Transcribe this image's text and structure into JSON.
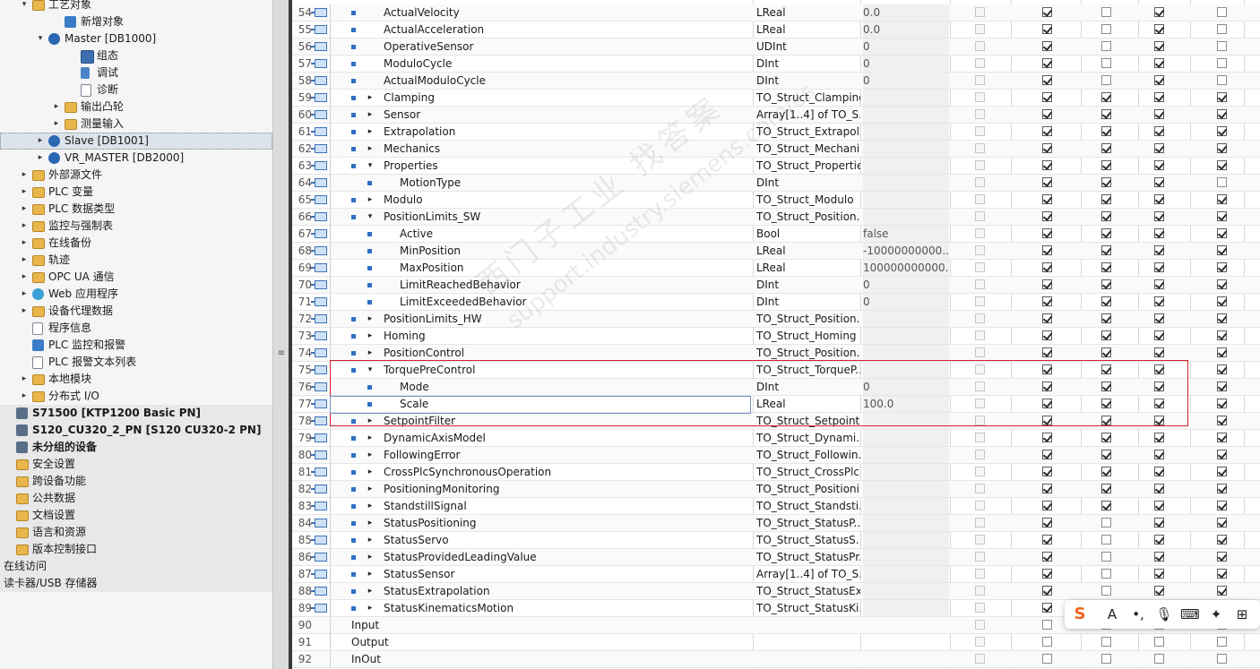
{
  "tree": [
    {
      "label": "工艺对象",
      "indent": 1,
      "arrow": "▾",
      "icon": "folder",
      "state": ""
    },
    {
      "label": "新增对象",
      "indent": 3,
      "arrow": "",
      "icon": "blue",
      "state": ""
    },
    {
      "label": "Master [DB1000]",
      "indent": 2,
      "arrow": "▾",
      "icon": "gear",
      "state": ""
    },
    {
      "label": "组态",
      "indent": 4,
      "arrow": "",
      "icon": "cfg",
      "state": ""
    },
    {
      "label": "调试",
      "indent": 4,
      "arrow": "",
      "icon": "tool",
      "state": ""
    },
    {
      "label": "诊断",
      "indent": 4,
      "arrow": "",
      "icon": "doc",
      "state": ""
    },
    {
      "label": "输出凸轮",
      "indent": 3,
      "arrow": "▸",
      "icon": "folder",
      "state": ""
    },
    {
      "label": "测量输入",
      "indent": 3,
      "arrow": "▸",
      "icon": "folder",
      "state": ""
    },
    {
      "label": "Slave [DB1001]",
      "indent": 2,
      "arrow": "▸",
      "icon": "gear",
      "state": "sel dotted"
    },
    {
      "label": "VR_MASTER [DB2000]",
      "indent": 2,
      "arrow": "▸",
      "icon": "gear",
      "state": ""
    },
    {
      "label": "外部源文件",
      "indent": 1,
      "arrow": "▸",
      "icon": "folder",
      "state": ""
    },
    {
      "label": "PLC 变量",
      "indent": 1,
      "arrow": "▸",
      "icon": "folder",
      "state": ""
    },
    {
      "label": "PLC 数据类型",
      "indent": 1,
      "arrow": "▸",
      "icon": "folder",
      "state": ""
    },
    {
      "label": "监控与强制表",
      "indent": 1,
      "arrow": "▸",
      "icon": "folder",
      "state": ""
    },
    {
      "label": "在线备份",
      "indent": 1,
      "arrow": "▸",
      "icon": "folder",
      "state": ""
    },
    {
      "label": "轨迹",
      "indent": 1,
      "arrow": "▸",
      "icon": "folder",
      "state": ""
    },
    {
      "label": "OPC UA 通信",
      "indent": 1,
      "arrow": "▸",
      "icon": "folder",
      "state": ""
    },
    {
      "label": "Web 应用程序",
      "indent": 1,
      "arrow": "▸",
      "icon": "net",
      "state": ""
    },
    {
      "label": "设备代理数据",
      "indent": 1,
      "arrow": "▸",
      "icon": "folder",
      "state": ""
    },
    {
      "label": "程序信息",
      "indent": 1,
      "arrow": "",
      "icon": "doc",
      "state": ""
    },
    {
      "label": "PLC 监控和报警",
      "indent": 1,
      "arrow": "",
      "icon": "blue",
      "state": ""
    },
    {
      "label": "PLC 报警文本列表",
      "indent": 1,
      "arrow": "",
      "icon": "doc",
      "state": ""
    },
    {
      "label": "本地模块",
      "indent": 1,
      "arrow": "▸",
      "icon": "folder",
      "state": ""
    },
    {
      "label": "分布式 I/O",
      "indent": 1,
      "arrow": "▸",
      "icon": "folder",
      "state": ""
    },
    {
      "label": "S71500 [KTP1200 Basic PN]",
      "indent": 0,
      "arrow": "",
      "icon": "dev",
      "state": "gray bold"
    },
    {
      "label": "S120_CU320_2_PN [S120 CU320-2 PN]",
      "indent": 0,
      "arrow": "",
      "icon": "dev",
      "state": "gray bold"
    },
    {
      "label": "未分组的设备",
      "indent": 0,
      "arrow": "",
      "icon": "dev",
      "state": "gray bold"
    },
    {
      "label": "安全设置",
      "indent": 0,
      "arrow": "",
      "icon": "folder",
      "state": "gray"
    },
    {
      "label": "跨设备功能",
      "indent": 0,
      "arrow": "",
      "icon": "folder",
      "state": "gray"
    },
    {
      "label": "公共数据",
      "indent": 0,
      "arrow": "",
      "icon": "folder",
      "state": "gray"
    },
    {
      "label": "文档设置",
      "indent": 0,
      "arrow": "",
      "icon": "folder",
      "state": "gray"
    },
    {
      "label": "语言和资源",
      "indent": 0,
      "arrow": "",
      "icon": "folder",
      "state": "gray"
    },
    {
      "label": "版本控制接口",
      "indent": 0,
      "arrow": "",
      "icon": "folder",
      "state": "gray"
    },
    {
      "label": "在线访问",
      "indent": 0,
      "arrow": "",
      "icon": "",
      "state": "gray"
    },
    {
      "label": "读卡器/USB 存储器",
      "indent": 0,
      "arrow": "",
      "icon": "",
      "state": "gray"
    }
  ],
  "splitter_grip": "≡",
  "rows": [
    {
      "num": "54",
      "icon": true,
      "level": 1,
      "exp": "",
      "name": "ActualVelocity",
      "type": "LReal",
      "start": "0.0",
      "cb": [
        0,
        1,
        0,
        1,
        0
      ]
    },
    {
      "num": "55",
      "icon": true,
      "level": 1,
      "exp": "",
      "name": "ActualAcceleration",
      "type": "LReal",
      "start": "0.0",
      "cb": [
        0,
        1,
        0,
        1,
        0
      ]
    },
    {
      "num": "56",
      "icon": true,
      "level": 1,
      "exp": "",
      "name": "OperativeSensor",
      "type": "UDInt",
      "start": "0",
      "cb": [
        0,
        1,
        0,
        1,
        0
      ]
    },
    {
      "num": "57",
      "icon": true,
      "level": 1,
      "exp": "",
      "name": "ModuloCycle",
      "type": "DInt",
      "start": "0",
      "cb": [
        0,
        1,
        0,
        1,
        0
      ]
    },
    {
      "num": "58",
      "icon": true,
      "level": 1,
      "exp": "",
      "name": "ActualModuloCycle",
      "type": "DInt",
      "start": "0",
      "cb": [
        0,
        1,
        0,
        1,
        0
      ]
    },
    {
      "num": "59",
      "icon": true,
      "level": 1,
      "exp": "▸",
      "name": "Clamping",
      "type": "TO_Struct_Clamping",
      "start": "",
      "cb": [
        0,
        1,
        1,
        1,
        1
      ]
    },
    {
      "num": "60",
      "icon": true,
      "level": 1,
      "exp": "▸",
      "name": "Sensor",
      "type": "Array[1..4] of TO_S...",
      "start": "",
      "cb": [
        0,
        1,
        1,
        1,
        1
      ]
    },
    {
      "num": "61",
      "icon": true,
      "level": 1,
      "exp": "▸",
      "name": "Extrapolation",
      "type": "TO_Struct_Extrapol...",
      "start": "",
      "cb": [
        0,
        1,
        1,
        1,
        1
      ]
    },
    {
      "num": "62",
      "icon": true,
      "level": 1,
      "exp": "▸",
      "name": "Mechanics",
      "type": "TO_Struct_Mechani...",
      "start": "",
      "cb": [
        0,
        1,
        1,
        1,
        1
      ]
    },
    {
      "num": "63",
      "icon": true,
      "level": 1,
      "exp": "▾",
      "name": "Properties",
      "type": "TO_Struct_Properties",
      "start": "",
      "cb": [
        0,
        1,
        1,
        1,
        1
      ]
    },
    {
      "num": "64",
      "icon": true,
      "level": 2,
      "exp": "",
      "name": "MotionType",
      "type": "DInt",
      "start": "",
      "cb": [
        0,
        1,
        1,
        1,
        0
      ]
    },
    {
      "num": "65",
      "icon": true,
      "level": 1,
      "exp": "▸",
      "name": "Modulo",
      "type": "TO_Struct_Modulo",
      "start": "",
      "cb": [
        0,
        1,
        1,
        1,
        1
      ]
    },
    {
      "num": "66",
      "icon": true,
      "level": 1,
      "exp": "▾",
      "name": "PositionLimits_SW",
      "type": "TO_Struct_Position...",
      "start": "",
      "cb": [
        0,
        1,
        1,
        1,
        1
      ]
    },
    {
      "num": "67",
      "icon": true,
      "level": 2,
      "exp": "",
      "name": "Active",
      "type": "Bool",
      "start": "false",
      "cb": [
        0,
        1,
        1,
        1,
        1
      ]
    },
    {
      "num": "68",
      "icon": true,
      "level": 2,
      "exp": "",
      "name": "MinPosition",
      "type": "LReal",
      "start": "-10000000000...0",
      "cb": [
        0,
        1,
        1,
        1,
        1
      ]
    },
    {
      "num": "69",
      "icon": true,
      "level": 2,
      "exp": "",
      "name": "MaxPosition",
      "type": "LReal",
      "start": "100000000000...",
      "cb": [
        0,
        1,
        1,
        1,
        1
      ]
    },
    {
      "num": "70",
      "icon": true,
      "level": 2,
      "exp": "",
      "name": "LimitReachedBehavior",
      "type": "DInt",
      "start": "0",
      "cb": [
        0,
        1,
        1,
        1,
        1
      ]
    },
    {
      "num": "71",
      "icon": true,
      "level": 2,
      "exp": "",
      "name": "LimitExceededBehavior",
      "type": "DInt",
      "start": "0",
      "cb": [
        0,
        1,
        1,
        1,
        1
      ]
    },
    {
      "num": "72",
      "icon": true,
      "level": 1,
      "exp": "▸",
      "name": "PositionLimits_HW",
      "type": "TO_Struct_Position...",
      "start": "",
      "cb": [
        0,
        1,
        1,
        1,
        1
      ]
    },
    {
      "num": "73",
      "icon": true,
      "level": 1,
      "exp": "▸",
      "name": "Homing",
      "type": "TO_Struct_Homing",
      "start": "",
      "cb": [
        0,
        1,
        1,
        1,
        1
      ]
    },
    {
      "num": "74",
      "icon": true,
      "level": 1,
      "exp": "▸",
      "name": "PositionControl",
      "type": "TO_Struct_Position...",
      "start": "",
      "cb": [
        0,
        1,
        1,
        1,
        1
      ]
    },
    {
      "num": "75",
      "icon": true,
      "level": 1,
      "exp": "▾",
      "name": "TorquePreControl",
      "type": "TO_Struct_TorqueP...",
      "start": "",
      "cb": [
        0,
        1,
        1,
        1,
        1
      ]
    },
    {
      "num": "76",
      "icon": true,
      "level": 2,
      "exp": "",
      "name": "Mode",
      "type": "DInt",
      "start": "0",
      "cb": [
        0,
        1,
        1,
        1,
        1
      ]
    },
    {
      "num": "77",
      "icon": true,
      "level": 2,
      "exp": "",
      "name": "Scale",
      "type": "LReal",
      "start": "100.0",
      "cb": [
        0,
        1,
        1,
        1,
        1
      ]
    },
    {
      "num": "78",
      "icon": true,
      "level": 1,
      "exp": "▸",
      "name": "SetpointFilter",
      "type": "TO_Struct_Setpoint...",
      "start": "",
      "cb": [
        0,
        1,
        1,
        1,
        1
      ]
    },
    {
      "num": "79",
      "icon": true,
      "level": 1,
      "exp": "▸",
      "name": "DynamicAxisModel",
      "type": "TO_Struct_Dynami...",
      "start": "",
      "cb": [
        0,
        1,
        1,
        1,
        1
      ]
    },
    {
      "num": "80",
      "icon": true,
      "level": 1,
      "exp": "▸",
      "name": "FollowingError",
      "type": "TO_Struct_Followin...",
      "start": "",
      "cb": [
        0,
        1,
        1,
        1,
        1
      ]
    },
    {
      "num": "81",
      "icon": true,
      "level": 1,
      "exp": "▸",
      "name": "CrossPlcSynchronousOperation",
      "type": "TO_Struct_CrossPlc...",
      "start": "",
      "cb": [
        0,
        1,
        1,
        1,
        1
      ]
    },
    {
      "num": "82",
      "icon": true,
      "level": 1,
      "exp": "▸",
      "name": "PositioningMonitoring",
      "type": "TO_Struct_Positioni...",
      "start": "",
      "cb": [
        0,
        1,
        1,
        1,
        1
      ]
    },
    {
      "num": "83",
      "icon": true,
      "level": 1,
      "exp": "▸",
      "name": "StandstillSignal",
      "type": "TO_Struct_Standsti...",
      "start": "",
      "cb": [
        0,
        1,
        1,
        1,
        1
      ]
    },
    {
      "num": "84",
      "icon": true,
      "level": 1,
      "exp": "▸",
      "name": "StatusPositioning",
      "type": "TO_Struct_StatusP...",
      "start": "",
      "cb": [
        0,
        1,
        0,
        1,
        1
      ]
    },
    {
      "num": "85",
      "icon": true,
      "level": 1,
      "exp": "▸",
      "name": "StatusServo",
      "type": "TO_Struct_StatusS...",
      "start": "",
      "cb": [
        0,
        1,
        0,
        1,
        1
      ]
    },
    {
      "num": "86",
      "icon": true,
      "level": 1,
      "exp": "▸",
      "name": "StatusProvidedLeadingValue",
      "type": "TO_Struct_StatusPr...",
      "start": "",
      "cb": [
        0,
        1,
        0,
        1,
        1
      ]
    },
    {
      "num": "87",
      "icon": true,
      "level": 1,
      "exp": "▸",
      "name": "StatusSensor",
      "type": "Array[1..4] of TO_S...",
      "start": "",
      "cb": [
        0,
        1,
        0,
        1,
        1
      ]
    },
    {
      "num": "88",
      "icon": true,
      "level": 1,
      "exp": "▸",
      "name": "StatusExtrapolation",
      "type": "TO_Struct_StatusEx...",
      "start": "",
      "cb": [
        0,
        1,
        0,
        1,
        1
      ]
    },
    {
      "num": "89",
      "icon": true,
      "level": 1,
      "exp": "▸",
      "name": "StatusKinematicsMotion",
      "type": "TO_Struct_StatusKi...",
      "start": "",
      "cb": [
        0,
        1,
        0,
        1,
        1
      ]
    },
    {
      "num": "90",
      "icon": false,
      "level": 0,
      "exp": "",
      "name": "Input",
      "type": "",
      "start": "",
      "cb": [
        0,
        0,
        0,
        0,
        0
      ]
    },
    {
      "num": "91",
      "icon": false,
      "level": 0,
      "exp": "",
      "name": "Output",
      "type": "",
      "start": "",
      "cb": [
        0,
        0,
        0,
        0,
        0
      ]
    },
    {
      "num": "92",
      "icon": false,
      "level": 0,
      "exp": "",
      "name": "InOut",
      "type": "",
      "start": "",
      "cb": [
        0,
        0,
        0,
        0,
        0
      ]
    }
  ],
  "watermark": {
    "line1": "西门子工业 找答案",
    "line2": "support.industry.siemens.com/cs"
  },
  "ime_toolbar": {
    "logo": "S",
    "items": [
      "A",
      "•,",
      "🎙",
      "⌨",
      "✦",
      "⊞"
    ]
  }
}
